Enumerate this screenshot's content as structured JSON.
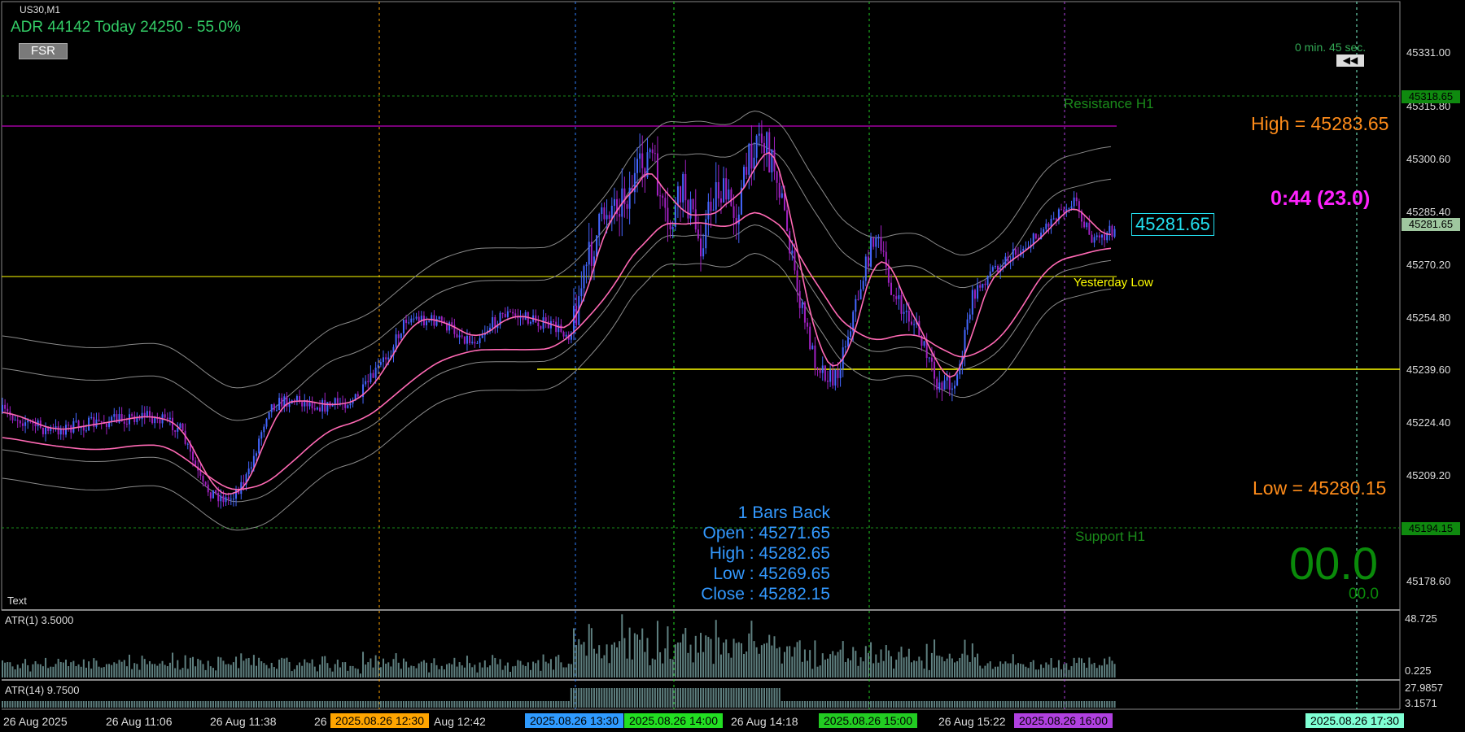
{
  "symbol": "US30,M1",
  "adr_line": "ADR 44142  Today 24250 - 55.0%",
  "fsr_label": "FSR",
  "countdown": "0 min. 45 sec.",
  "nav_icon": "◀◀",
  "resistance_label": "Resistance H1",
  "support_label": "Support H1",
  "yesterday_low_label": "Yesterday Low",
  "high_text": "High = 45283.65",
  "low_text": "Low = 45280.15",
  "timer_text": "0:44 (23.0)",
  "big_number": "00.0",
  "small_number": "00.0",
  "current_price": "45281.65",
  "text_label": "Text",
  "bars_back": {
    "title": "1 Bars Back",
    "open": "Open : 45271.65",
    "high": "High : 45282.65",
    "low": "Low : 45269.65",
    "close": "Close : 45282.15"
  },
  "price_axis": [
    "45331.00",
    "45315.80",
    "45300.60",
    "45285.40",
    "45270.20",
    "45254.80",
    "45239.60",
    "45224.40",
    "45209.20",
    "45194.15",
    "45178.60"
  ],
  "axis_tags": {
    "resistance": "45318.65",
    "current": "45281.65",
    "support": "45194.15"
  },
  "atr1": {
    "label": "ATR(1) 3.5000",
    "max": "48.725",
    "min": "0.225"
  },
  "atr14": {
    "label": "ATR(14) 9.7500",
    "max": "27.9857",
    "min": "3.1571"
  },
  "time_labels": [
    "26 Aug 2025",
    "26 Aug 11:06",
    "26 Aug 11:38",
    "26",
    "Aug 12:42",
    "26 Aug 14:18",
    "26 Aug 15:22"
  ],
  "time_tags": [
    {
      "label": "2025.08.26 12:30",
      "color": "#ffa500"
    },
    {
      "label": "2025.08.26 13:30",
      "color": "#2f9bff"
    },
    {
      "label": "2025.08.26 14:00",
      "color": "#22e022"
    },
    {
      "label": "2025.08.26 15:00",
      "color": "#22cc22"
    },
    {
      "label": "2025.08.26 16:00",
      "color": "#b040e0"
    },
    {
      "label": "2025.08.26 17:30",
      "color": "#7fffd4"
    }
  ],
  "colors": {
    "background": "#000000",
    "candle_up": "#4466ff",
    "candle_down": "#a020c0",
    "ma": "#ff69b4",
    "bands": "#8a8a8a",
    "yellow_level": "#ffff00",
    "magenta_level": "#a000a0",
    "info_text": "#3399ff",
    "high_low_text": "#ff8c1a",
    "big_number": "#0a8a0a"
  }
}
